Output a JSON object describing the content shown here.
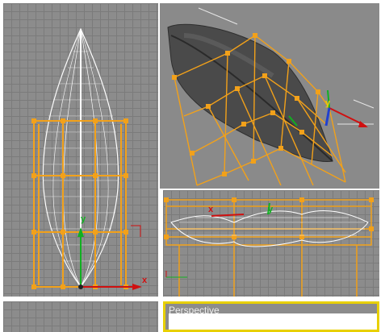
{
  "viewports": {
    "front": {
      "axis_x": "x",
      "axis_y": "y"
    },
    "perspective_top": {
      "axis_x": "x",
      "axis_y": "y"
    },
    "left": {
      "axis_x": "x",
      "axis_y": "y"
    },
    "bottom_right": {
      "label": "Perspective"
    }
  },
  "colors": {
    "viewport_bg": "#8c8c8c",
    "lattice": "#f2a11a",
    "wire": "#ffffff",
    "axis_x": "#d01010",
    "axis_y": "#10b020",
    "axis_z": "#2040d0",
    "active_border": "#e8d000"
  }
}
